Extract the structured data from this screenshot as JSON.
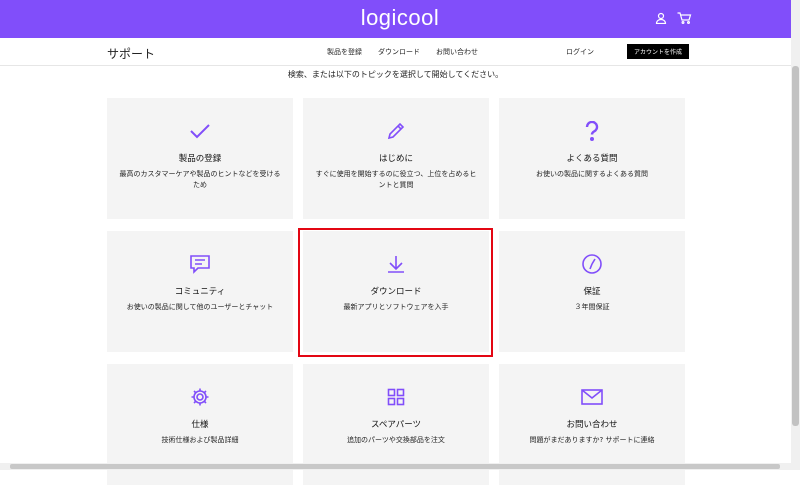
{
  "header": {
    "logo": "logicool",
    "icons": [
      "user-icon",
      "cart-icon"
    ],
    "accent": "#814efa"
  },
  "subnav": {
    "title": "サポート",
    "links": [
      "製品を登録",
      "ダウンロード",
      "お問い合わせ"
    ],
    "login": "ログイン",
    "create_account": "アカウントを作成"
  },
  "intro": "検索、または以下のトピックを選択して開始してください。",
  "cards": [
    {
      "icon": "checkmark-icon",
      "title": "製品の登録",
      "desc": "最高のカスタマーケアや製品のヒントなどを受けるため"
    },
    {
      "icon": "pencil-icon",
      "title": "はじめに",
      "desc": "すぐに使用を開始するのに役立つ、上位を占めるヒントと質問"
    },
    {
      "icon": "question-icon",
      "title": "よくある質問",
      "desc": "お使いの製品に関するよくある質問"
    },
    {
      "icon": "chat-icon",
      "title": "コミュニティ",
      "desc": "お使いの製品に関して他のユーザーとチャット"
    },
    {
      "icon": "download-icon",
      "title": "ダウンロード",
      "desc": "最新アプリとソフトウェアを入手"
    },
    {
      "icon": "warranty-icon",
      "title": "保証",
      "desc": "３年間保証"
    },
    {
      "icon": "gear-icon",
      "title": "仕様",
      "desc": "技術仕様および製品詳細"
    },
    {
      "icon": "grid-icon",
      "title": "スペアパーツ",
      "desc": "追加のパーツや交換部品を注文"
    },
    {
      "icon": "envelope-icon",
      "title": "お問い合わせ",
      "desc": "問題がまだありますか? サポートに連絡"
    }
  ]
}
